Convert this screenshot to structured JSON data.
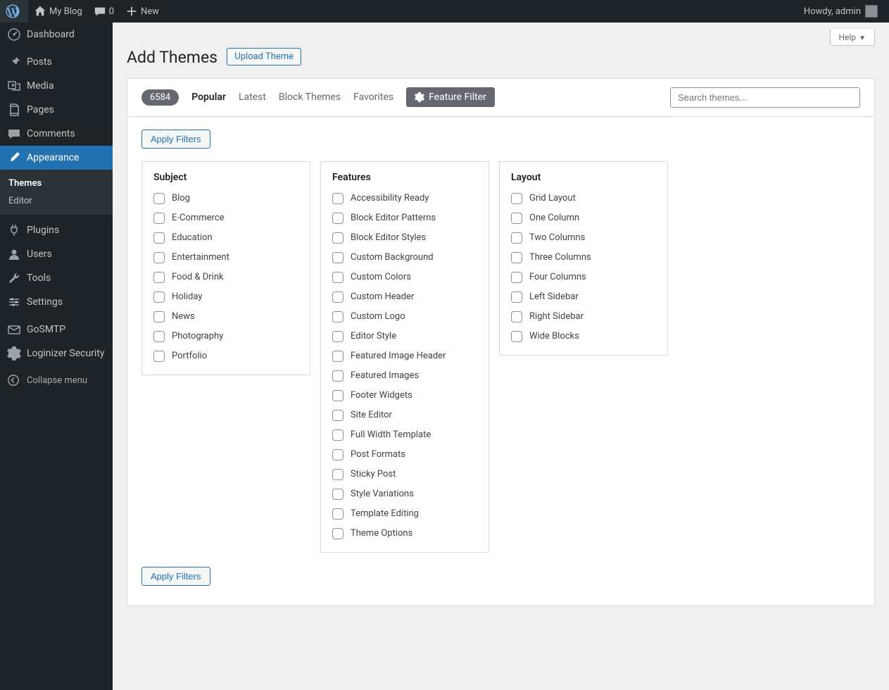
{
  "adminbar": {
    "site_name": "My Blog",
    "comments_count": "0",
    "new_label": "New",
    "howdy": "Howdy, admin"
  },
  "sidebar": {
    "items": [
      {
        "label": "Dashboard",
        "icon": "dashboard"
      },
      {
        "label": "Posts",
        "icon": "pin"
      },
      {
        "label": "Media",
        "icon": "media"
      },
      {
        "label": "Pages",
        "icon": "pages"
      },
      {
        "label": "Comments",
        "icon": "comment"
      },
      {
        "label": "Appearance",
        "icon": "brush",
        "current": true
      },
      {
        "label": "Plugins",
        "icon": "plug"
      },
      {
        "label": "Users",
        "icon": "user"
      },
      {
        "label": "Tools",
        "icon": "wrench"
      },
      {
        "label": "Settings",
        "icon": "sliders"
      },
      {
        "label": "GoSMTP",
        "icon": "mail"
      },
      {
        "label": "Loginizer Security",
        "icon": "gear"
      }
    ],
    "submenu": [
      {
        "label": "Themes",
        "current": true
      },
      {
        "label": "Editor"
      }
    ],
    "collapse": "Collapse menu"
  },
  "page": {
    "help": "Help",
    "title": "Add Themes",
    "upload": "Upload Theme",
    "count": "6584",
    "tabs": {
      "popular": "Popular",
      "latest": "Latest",
      "block": "Block Themes",
      "favorites": "Favorites",
      "feature_filter": "Feature Filter"
    },
    "search_placeholder": "Search themes...",
    "apply": "Apply Filters",
    "filter_groups": [
      {
        "title": "Subject",
        "options": [
          "Blog",
          "E-Commerce",
          "Education",
          "Entertainment",
          "Food & Drink",
          "Holiday",
          "News",
          "Photography",
          "Portfolio"
        ]
      },
      {
        "title": "Features",
        "options": [
          "Accessibility Ready",
          "Block Editor Patterns",
          "Block Editor Styles",
          "Custom Background",
          "Custom Colors",
          "Custom Header",
          "Custom Logo",
          "Editor Style",
          "Featured Image Header",
          "Featured Images",
          "Footer Widgets",
          "Site Editor",
          "Full Width Template",
          "Post Formats",
          "Sticky Post",
          "Style Variations",
          "Template Editing",
          "Theme Options"
        ]
      },
      {
        "title": "Layout",
        "options": [
          "Grid Layout",
          "One Column",
          "Two Columns",
          "Three Columns",
          "Four Columns",
          "Left Sidebar",
          "Right Sidebar",
          "Wide Blocks"
        ]
      }
    ]
  }
}
